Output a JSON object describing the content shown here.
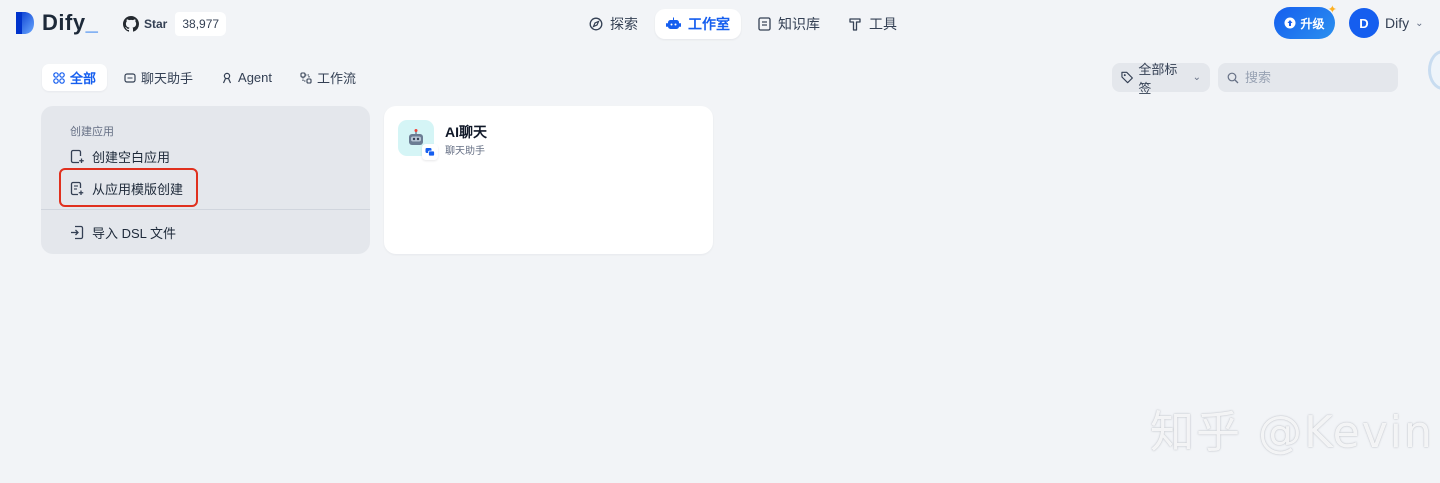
{
  "header": {
    "logo_text": "Dify",
    "github": {
      "star_label": "Star",
      "star_count": "38,977"
    },
    "nav": [
      {
        "label": "探索",
        "icon": "compass-icon",
        "active": false
      },
      {
        "label": "工作室",
        "icon": "robot-icon",
        "active": true
      },
      {
        "label": "知识库",
        "icon": "book-icon",
        "active": false
      },
      {
        "label": "工具",
        "icon": "hammer-icon",
        "active": false
      }
    ],
    "upgrade_label": "升级",
    "user": {
      "avatar_letter": "D",
      "name": "Dify"
    }
  },
  "filters": {
    "tabs": [
      {
        "label": "全部",
        "icon": "grid-icon",
        "active": true
      },
      {
        "label": "聊天助手",
        "icon": "chat-icon",
        "active": false
      },
      {
        "label": "Agent",
        "icon": "agent-icon",
        "active": false
      },
      {
        "label": "工作流",
        "icon": "workflow-icon",
        "active": false
      }
    ],
    "tag_label": "全部标签",
    "search_placeholder": "搜索"
  },
  "create_panel": {
    "title": "创建应用",
    "items": [
      {
        "label": "创建空白应用",
        "icon": "file-plus-icon"
      },
      {
        "label": "从应用模版创建",
        "icon": "template-icon"
      },
      {
        "label": "导入 DSL 文件",
        "icon": "import-icon"
      }
    ]
  },
  "apps": [
    {
      "name": "AI聊天",
      "type": "聊天助手",
      "icon": "robot-emoji-icon"
    }
  ],
  "watermark": "知乎 @Kevin",
  "colors": {
    "accent": "#155eef",
    "background": "#f2f4f7",
    "highlight": "#e0301e"
  }
}
